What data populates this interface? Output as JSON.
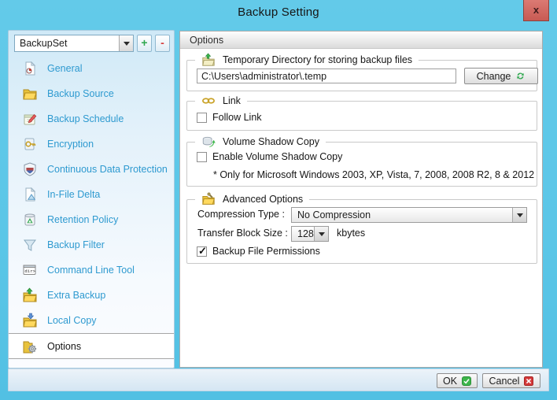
{
  "window": {
    "title": "Backup Setting",
    "close_label": "x"
  },
  "sidebar": {
    "backupset_label": "BackupSet",
    "add_label": "+",
    "remove_label": "-",
    "items": [
      {
        "label": "General",
        "icon": "icon-general",
        "selected": false
      },
      {
        "label": "Backup Source",
        "icon": "icon-backup-source",
        "selected": false
      },
      {
        "label": "Backup Schedule",
        "icon": "icon-backup-schedule",
        "selected": false
      },
      {
        "label": "Encryption",
        "icon": "icon-encryption",
        "selected": false
      },
      {
        "label": "Continuous Data Protection",
        "icon": "icon-cdp",
        "selected": false
      },
      {
        "label": "In-File Delta",
        "icon": "icon-in-file-delta",
        "selected": false
      },
      {
        "label": "Retention Policy",
        "icon": "icon-retention",
        "selected": false
      },
      {
        "label": "Backup Filter",
        "icon": "icon-filter",
        "selected": false
      },
      {
        "label": "Command Line Tool",
        "icon": "icon-cmd",
        "selected": false
      },
      {
        "label": "Extra Backup",
        "icon": "icon-extra-backup",
        "selected": false
      },
      {
        "label": "Local Copy",
        "icon": "icon-local-copy",
        "selected": false
      },
      {
        "label": "Options",
        "icon": "icon-options",
        "selected": true
      }
    ]
  },
  "panel": {
    "header": "Options",
    "temp_section": {
      "title": "Temporary Directory for storing backup files",
      "path_value": "C:\\Users\\administrator\\.temp",
      "change_label": "Change"
    },
    "link_section": {
      "title": "Link",
      "follow_link_label": "Follow Link",
      "follow_link_checked": false
    },
    "vss_section": {
      "title": "Volume Shadow Copy",
      "enable_label": "Enable Volume Shadow Copy",
      "enable_checked": false,
      "note": "* Only for Microsoft Windows 2003, XP, Vista, 7, 2008, 2008 R2, 8 & 2012"
    },
    "advanced_section": {
      "title": "Advanced Options",
      "compression_label": "Compression Type :",
      "compression_value": "No Compression",
      "block_label": "Transfer Block Size :",
      "block_value": "128",
      "block_unit": "kbytes",
      "permissions_label": "Backup File Permissions",
      "permissions_checked": true
    }
  },
  "footer": {
    "ok_label": "OK",
    "cancel_label": "Cancel"
  },
  "colors": {
    "titlebar": "#5BC6E7",
    "close_button": "#CD5C5C",
    "sidebar_link_text": "#2E9AD0",
    "ok_green": "#3CB54A",
    "cancel_red": "#D43A3A",
    "panel_border": "#ABABAB"
  }
}
